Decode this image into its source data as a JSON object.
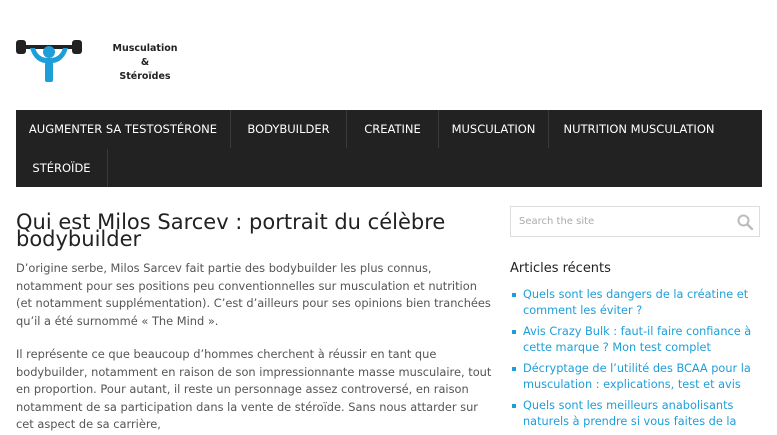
{
  "site": {
    "logo_line1": "Musculation",
    "logo_line2": "&",
    "logo_line3": "Stéroïdes",
    "logo_icon": "barbell-person-icon",
    "logo_color": "#1e9ed9"
  },
  "nav": {
    "items": [
      "AUGMENTER SA TESTOSTÉRONE",
      "BODYBUILDER",
      "CREATINE",
      "MUSCULATION",
      "NUTRITION MUSCULATION",
      "STÉROÏDE"
    ]
  },
  "post": {
    "title": "Qui est Milos Sarcev : portrait du célèbre bodybuilder",
    "paragraph1": "D’origine serbe, Milos Sarcev fait partie des bodybuilder les plus connus, notamment pour ses positions peu conventionnelles sur musculation et nutrition (et notamment supplémentation). C’est d’ailleurs pour ses opinions bien tranchées qu’il a été surnommé « The Mind ».",
    "paragraph2": "Il représente ce que beaucoup d’hommes cherchent à réussir en tant que bodybuilder, notamment en raison de son impressionnante masse musculaire, tout en proportion. Pour autant, il reste un personnage assez controversé, en raison notamment de sa participation dans la vente de stéroïde. Sans nous attarder sur cet aspect de sa carrière,"
  },
  "sidebar": {
    "search_placeholder": "Search the site",
    "search_icon": "search-icon",
    "recent_title": "Articles récents",
    "recent": [
      "Quels sont les dangers de la créatine et comment les éviter ?",
      "Avis Crazy Bulk : faut-il faire confiance à cette marque ? Mon test complet",
      "Décryptage de l’utilité des BCAA pour la musculation : explications, test et avis",
      "Quels sont les meilleurs anabolisants naturels à prendre si vous faites de la"
    ],
    "link_color": "#1e9ed9"
  }
}
